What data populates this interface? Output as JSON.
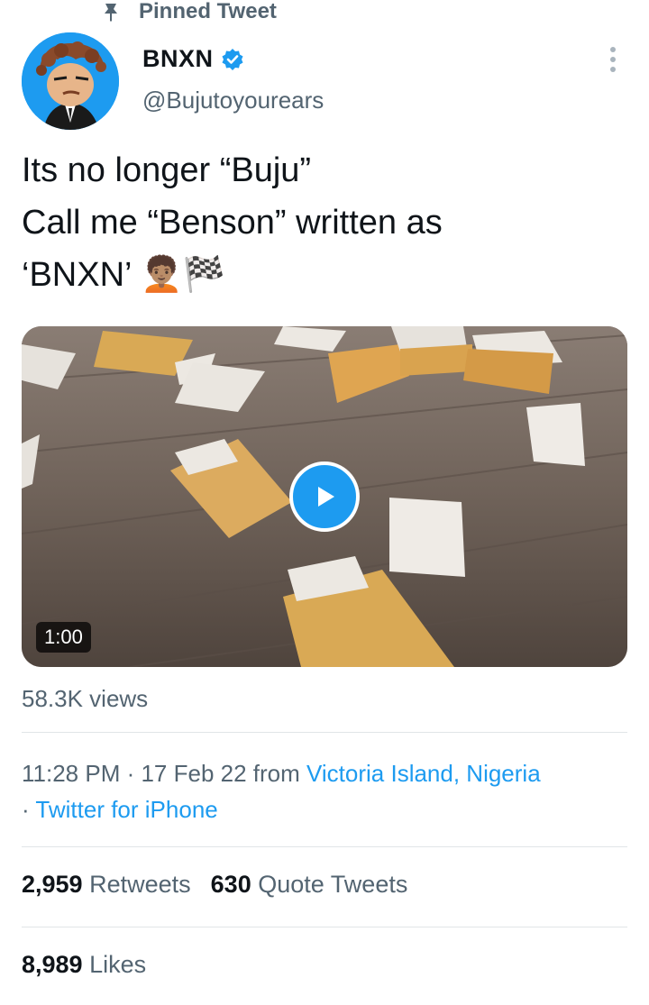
{
  "pinned": {
    "label": "Pinned Tweet",
    "icon": "pin-icon"
  },
  "author": {
    "name": "BNXN",
    "handle": "@Bujutoyourears",
    "verified_icon": "verified-badge-icon"
  },
  "tweet": {
    "lines": [
      "Its no longer “Buju”",
      "Call me “Benson” written as",
      "‘BNXN’ 🧑🏽‍🦱🏁"
    ]
  },
  "media": {
    "duration": "1:00",
    "play_icon": "play-icon"
  },
  "views": "58.3K views",
  "meta": {
    "time": "11:28 PM",
    "separator": " · ",
    "date": "17 Feb 22",
    "from_word": " from ",
    "location": "Victoria Island, Nigeria",
    "leading_dot": "· ",
    "source": "Twitter for iPhone"
  },
  "stats": {
    "retweets_count": "2,959",
    "retweets_label": "Retweets",
    "quotes_count": "630",
    "quotes_label": "Quote Tweets",
    "likes_count": "8,989",
    "likes_label": "Likes"
  },
  "colors": {
    "accent": "#1d9bf0",
    "secondary_text": "#536471",
    "primary_text": "#0f1419"
  }
}
